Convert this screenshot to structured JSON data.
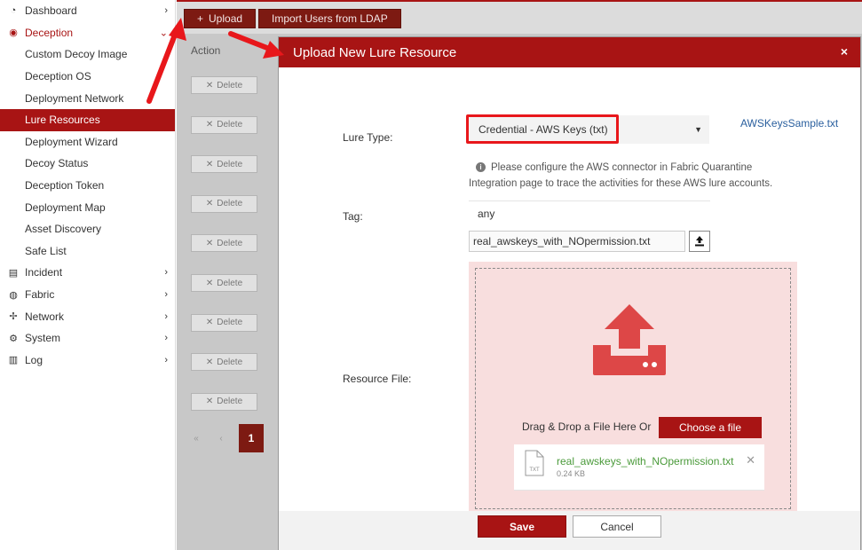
{
  "sidebar": {
    "items": [
      {
        "label": "Dashboard",
        "icon": "dashboard-icon",
        "expanded": false
      },
      {
        "label": "Deception",
        "icon": "deception-icon",
        "expanded": true,
        "children": [
          "Custom Decoy Image",
          "Deception OS",
          "Deployment Network",
          "Lure Resources",
          "Deployment Wizard",
          "Decoy Status",
          "Deception Token",
          "Deployment Map",
          "Asset Discovery",
          "Safe List"
        ],
        "active_child": "Lure Resources"
      },
      {
        "label": "Incident",
        "icon": "incident-icon",
        "expanded": false
      },
      {
        "label": "Fabric",
        "icon": "fabric-icon",
        "expanded": false
      },
      {
        "label": "Network",
        "icon": "network-icon",
        "expanded": false
      },
      {
        "label": "System",
        "icon": "gear-icon",
        "expanded": false
      },
      {
        "label": "Log",
        "icon": "log-icon",
        "expanded": false
      }
    ]
  },
  "main": {
    "toolbar": {
      "upload_label": "Upload",
      "import_label": "Import Users from LDAP"
    },
    "table": {
      "action_header": "Action",
      "delete_label": "Delete",
      "row_count": 9
    },
    "pagination": {
      "first": "«",
      "prev": "‹",
      "current": "1"
    }
  },
  "modal": {
    "title": "Upload New Lure Resource",
    "close": "×",
    "lure_type_label": "Lure Type:",
    "lure_type_value": "Credential - AWS Keys (txt)",
    "sample_link": "AWSKeysSample.txt",
    "info_text": "Please configure the AWS connector in Fabric Quarantine Integration page to trace the activities for these AWS lure accounts.",
    "tag_label": "Tag:",
    "tag_value": "any",
    "file_name": "real_awskeys_with_NOpermission.txt",
    "resource_file_label": "Resource File:",
    "drag_text": "Drag & Drop a File Here Or",
    "choose_label": "Choose a file",
    "uploaded_file": {
      "name": "real_awskeys_with_NOpermission.txt",
      "size": "0.24 KB",
      "type": "TXT"
    },
    "save_label": "Save",
    "cancel_label": "Cancel"
  },
  "colors": {
    "brand": "#a81414",
    "annotation": "#e8171b",
    "upload_icon": "#dd4747"
  }
}
